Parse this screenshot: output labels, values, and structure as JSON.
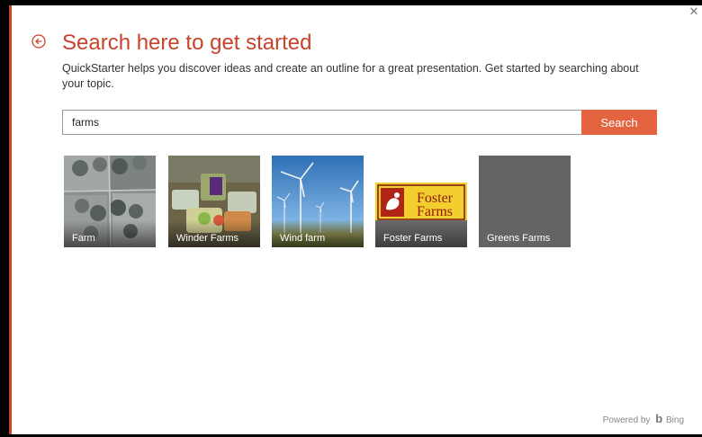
{
  "header": {
    "title": "Search here to get started",
    "description": "QuickStarter helps you discover ideas and create an outline for a great presentation. Get started by searching about your topic."
  },
  "search": {
    "value": "farms",
    "button_label": "Search"
  },
  "results": [
    {
      "label": "Farm"
    },
    {
      "label": "Winder Farms"
    },
    {
      "label": "Wind farm"
    },
    {
      "label": "Foster Farms",
      "logo_text": "Foster Farms"
    },
    {
      "label": "Greens Farms"
    }
  ],
  "footer": {
    "powered_by": "Powered by",
    "brand": "Bing"
  },
  "colors": {
    "accent": "#c8432a",
    "search_button": "#e3643f"
  },
  "icons": {
    "back": "back-arrow-circle-icon",
    "close": "close-icon",
    "bing": "bing-logo-icon"
  }
}
